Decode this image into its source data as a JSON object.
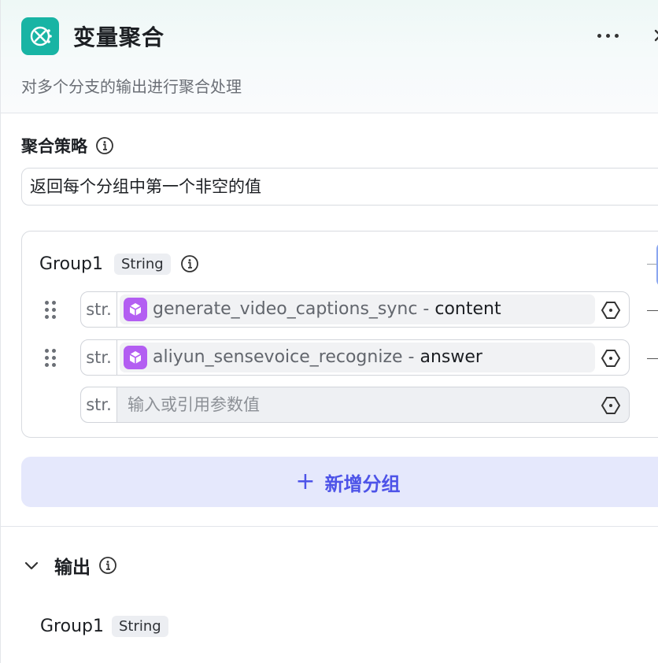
{
  "header": {
    "title": "变量聚合",
    "subtitle": "对多个分支的输出进行聚合处理",
    "node_icon": "variable-x-icon",
    "accent_color": "#18b4a4"
  },
  "strategy": {
    "label": "聚合策略",
    "value": "返回每个分组中第一个非空的值"
  },
  "group": {
    "name": "Group1",
    "type": "String",
    "variables": [
      {
        "type": "str.",
        "node": "generate_video_captions_sync",
        "separator": " - ",
        "field": "content"
      },
      {
        "type": "str.",
        "node": "aliyun_sensevoice_recognize",
        "separator": " - ",
        "field": "answer"
      }
    ],
    "empty_row": {
      "type": "str.",
      "placeholder": "输入或引用参数值"
    }
  },
  "add_group": {
    "plus": "+",
    "label": "新增分组",
    "color": "#4d53e8"
  },
  "output": {
    "title": "输出",
    "items": [
      {
        "name": "Group1",
        "type": "String"
      }
    ]
  },
  "colors": {
    "ref_icon": "#b35ef2",
    "add_bg": "#e5e8fc"
  }
}
